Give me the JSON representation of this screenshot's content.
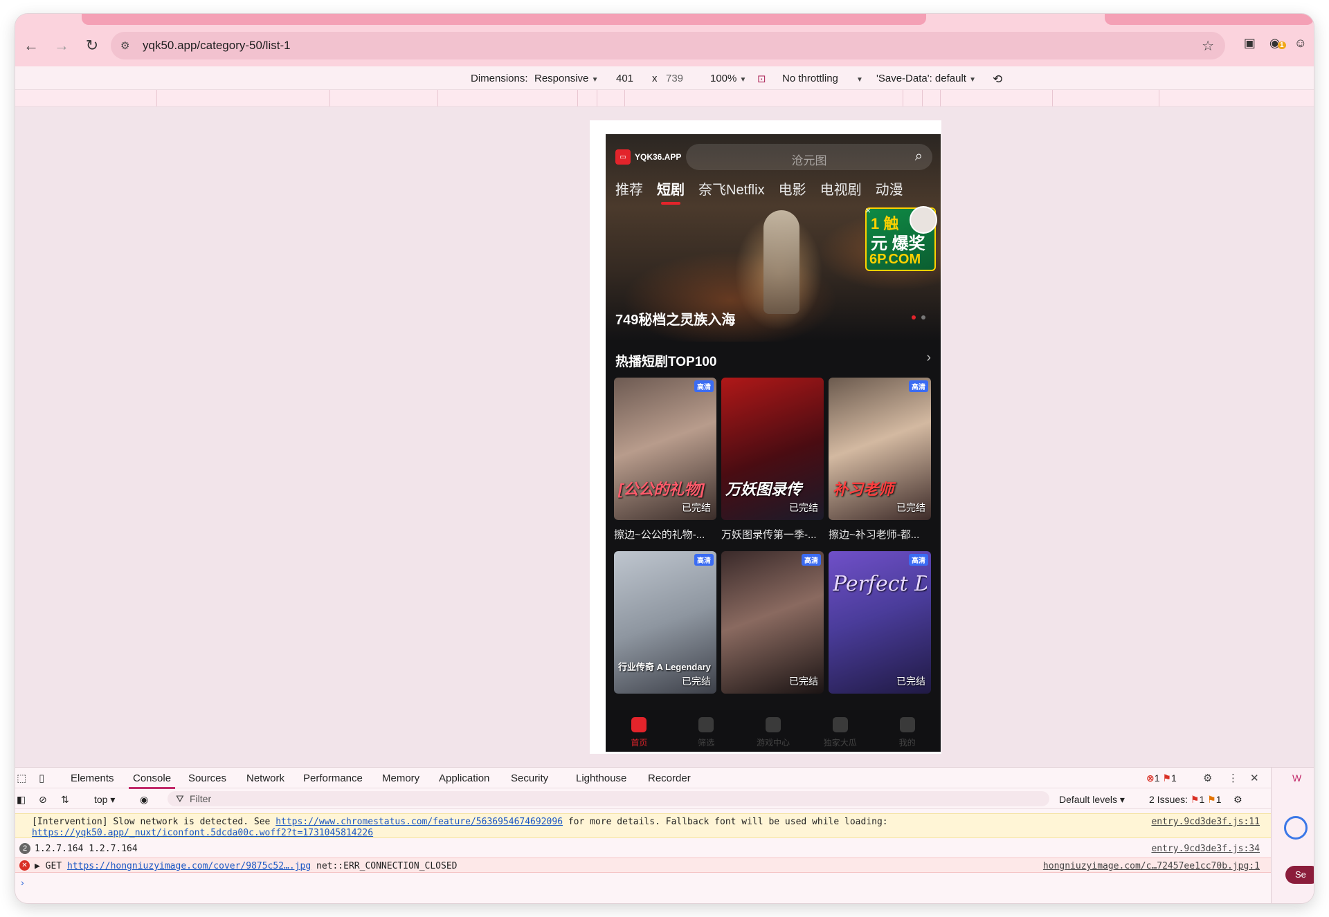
{
  "browser": {
    "url": "yqk50.app/category-50/list-1",
    "extension_badge": "1"
  },
  "device_toolbar": {
    "dimensions_label": "Dimensions:",
    "device": "Responsive",
    "width": "401",
    "times": "x",
    "height": "739",
    "zoom": "100%",
    "throttling": "No throttling",
    "save_data": "'Save-Data': default"
  },
  "app": {
    "logo_text": "YQK36.APP",
    "search_placeholder": "沧元图",
    "categories": [
      "推荐",
      "短剧",
      "奈飞Netflix",
      "电影",
      "电视剧",
      "动漫"
    ],
    "active_category": 1,
    "hero": {
      "title": "749秘档之灵族入海",
      "ad_line1": "1 触",
      "ad_line2": "元 爆奖",
      "ad_line3": "6P.COM"
    },
    "section_title": "热播短剧TOP100",
    "cards": [
      {
        "badge": "高清",
        "status": "已完结",
        "overlay": "[公公的礼物]",
        "caption": "擦边~公公的礼物-..."
      },
      {
        "badge": "高清",
        "status": "已完结",
        "overlay": "万妖图录传",
        "caption": "万妖图录传第一季-..."
      },
      {
        "badge": "高清",
        "status": "已完结",
        "overlay": "补习老师",
        "caption": "擦边~补习老师-都..."
      },
      {
        "badge": "高清",
        "status": "已完结",
        "overlay": "行业传奇 A Legendary Life",
        "caption": ""
      },
      {
        "badge": "高清",
        "status": "已完结",
        "overlay": "",
        "caption": ""
      },
      {
        "badge": "高清",
        "status": "已完结",
        "overlay": "Perfect Del",
        "caption": ""
      }
    ],
    "tabbar": [
      {
        "label": "首页",
        "icon": "clapperboard-icon"
      },
      {
        "label": "筛选",
        "icon": "filter-icon"
      },
      {
        "label": "游戏中心",
        "icon": "game-icon"
      },
      {
        "label": "独家大瓜",
        "icon": "leaf-icon"
      },
      {
        "label": "我的",
        "icon": "profile-icon"
      }
    ]
  },
  "devtools": {
    "tabs": [
      "Elements",
      "Console",
      "Sources",
      "Network",
      "Performance",
      "Memory",
      "Application",
      "Security",
      "Lighthouse",
      "Recorder"
    ],
    "active_tab": "Console",
    "error_count": "1",
    "warning_count": "1",
    "context": "top",
    "filter_placeholder": "Filter",
    "levels": "Default levels",
    "issues_label": "2 Issues:",
    "issues_err": "1",
    "issues_warn": "1",
    "messages": {
      "warn_prefix": "[Intervention] Slow network is detected. See ",
      "warn_link": "https://www.chromestatus.com/feature/5636954674692096",
      "warn_mid": " for more details. Fallback font will be used while loading:",
      "warn_link2": "https://yqk50.app/_nuxt/iconfont.5dcda00c.woff2?t=1731045814226",
      "warn_src": "entry.9cd3de3f.js:11",
      "log_count": "2",
      "log_text": "1.2.7.164 1.2.7.164",
      "log_src": "entry.9cd3de3f.js:34",
      "err_prefix": "▶ GET ",
      "err_link": "https://hongniuzyimage.com/cover/9875c52….jpg",
      "err_suffix": " net::ERR_CONNECTION_CLOSED",
      "err_src": "hongniuzyimage.com/c…72457ee1cc70b.jpg:1"
    },
    "side_w": "W",
    "side_send": "Se"
  }
}
